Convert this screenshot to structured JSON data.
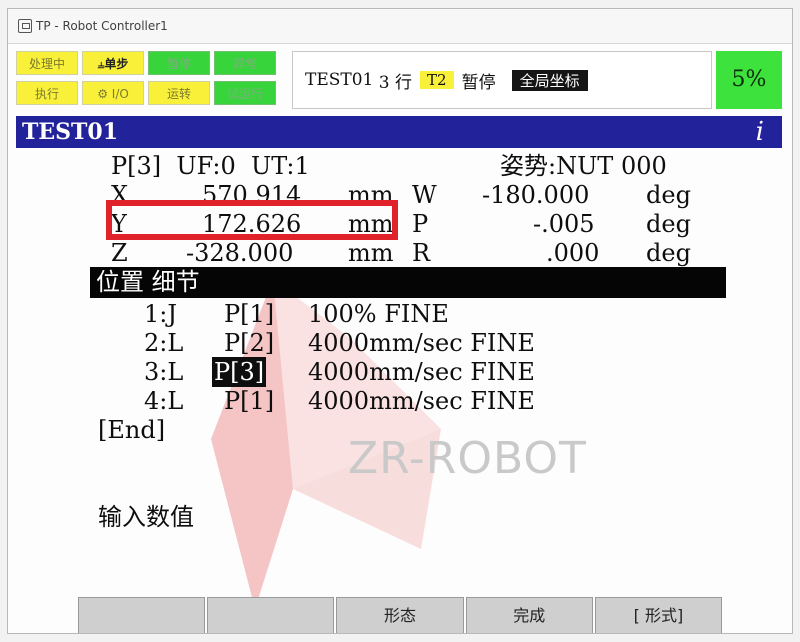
{
  "window": {
    "title": "TP - Robot Controller1"
  },
  "status_buttons": [
    {
      "label": "处理中",
      "style": "y"
    },
    {
      "label": "单步",
      "style": "y",
      "active": true
    },
    {
      "label": "暂停",
      "style": "g"
    },
    {
      "label": "异常",
      "style": "g"
    },
    {
      "label": "执行",
      "style": "y"
    },
    {
      "label": "I/O",
      "style": "y"
    },
    {
      "label": "运转",
      "style": "y"
    },
    {
      "label": "试运行",
      "style": "g"
    }
  ],
  "status_message": {
    "program": "TEST01",
    "line": "3 行",
    "mode": "T2",
    "state": "暂停",
    "coord": "全局坐标"
  },
  "override": "5%",
  "program": {
    "name": "TEST01",
    "info_icon": "i"
  },
  "position": {
    "header_left": "P[3]  UF:0  UT:1",
    "header_right": "姿势:NUT 000",
    "rows": [
      {
        "axis": "X",
        "value": "570.914",
        "unit": "mm",
        "raxis": "W",
        "rvalue": "-180.000",
        "runit": "deg"
      },
      {
        "axis": "Y",
        "value": "172.626",
        "unit": "mm",
        "raxis": "P",
        "rvalue": "-.005",
        "runit": "deg"
      },
      {
        "axis": "Z",
        "value": "-328.000",
        "unit": "mm",
        "raxis": "R",
        "rvalue": ".000",
        "runit": "deg"
      }
    ]
  },
  "detail_title": "位置 细节",
  "lines": [
    {
      "num": "1:J",
      "ref": "P[1]",
      "rest": "100% FINE"
    },
    {
      "num": "2:L",
      "ref": "P[2]",
      "rest": "4000mm/sec FINE"
    },
    {
      "num": "3:L",
      "ref": "P[3]",
      "rest": "4000mm/sec FINE",
      "cursor": true
    },
    {
      "num": "4:L",
      "ref": "P[1]",
      "rest": "4000mm/sec FINE"
    }
  ],
  "end_label": "[End]",
  "prompt": "输入数值",
  "watermark": "ZR-ROBOT",
  "function_keys": [
    "",
    "",
    "形态",
    "完成",
    "[ 形式]"
  ],
  "colors": {
    "title_bar": "#22229a",
    "highlight": "#e0232a",
    "yellow": "#f9f03a",
    "green": "#3ee23c"
  }
}
